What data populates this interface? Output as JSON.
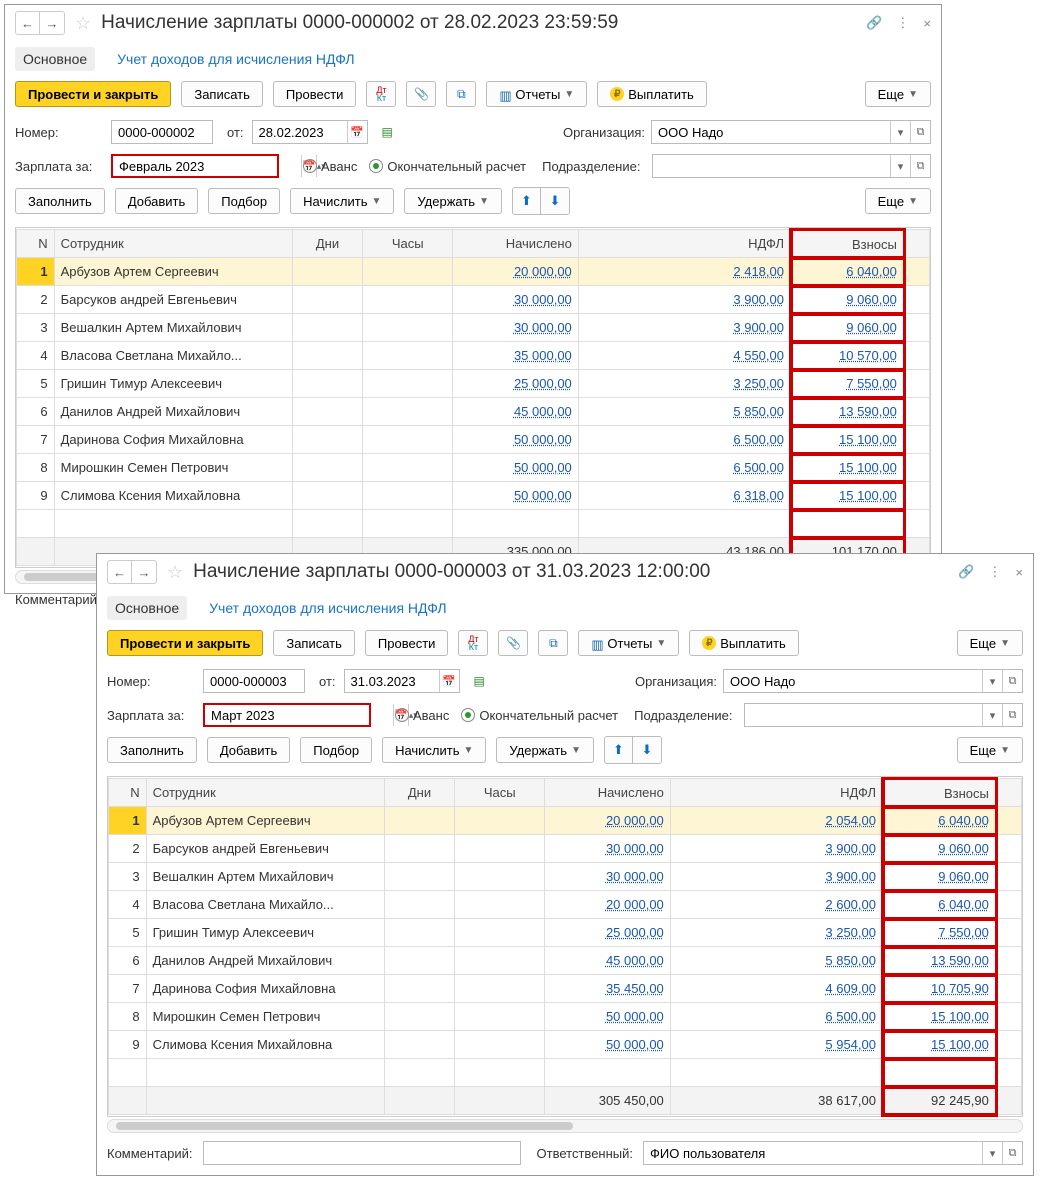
{
  "windows": [
    {
      "title": "Начисление зарплаты 0000-000002 от 28.02.2023 23:59:59",
      "tabs": {
        "main": "Основное",
        "link": "Учет доходов для исчисления НДФЛ"
      },
      "toolbar": {
        "post_close": "Провести и закрыть",
        "save": "Записать",
        "post": "Провести",
        "reports": "Отчеты",
        "pay": "Выплатить",
        "more": "Еще"
      },
      "form": {
        "number_lbl": "Номер:",
        "number_val": "0000-000002",
        "from_lbl": "от:",
        "date_val": "28.02.2023",
        "org_lbl": "Организация:",
        "org_val": "ООО Надо",
        "salary_for_lbl": "Зарплата за:",
        "period_val": "Февраль 2023",
        "advance": "Аванс",
        "final": "Окончательный расчет",
        "dept_lbl": "Подразделение:"
      },
      "toolbar2": {
        "fill": "Заполнить",
        "add": "Добавить",
        "select": "Подбор",
        "accrue": "Начислить",
        "withhold": "Удержать",
        "more": "Еще"
      },
      "columns": {
        "n": "N",
        "emp": "Сотрудник",
        "days": "Дни",
        "hours": "Часы",
        "accr": "Начислено",
        "ndfl": "НДФЛ",
        "vzn": "Взносы"
      },
      "rows": [
        {
          "n": "1",
          "emp": "Арбузов Артем Сергеевич",
          "accr": "20 000,00",
          "ndfl": "2 418,00",
          "vzn": "6 040,00",
          "hl": true
        },
        {
          "n": "2",
          "emp": "Барсуков андрей Евгеньевич",
          "accr": "30 000,00",
          "ndfl": "3 900,00",
          "vzn": "9 060,00"
        },
        {
          "n": "3",
          "emp": "Вешалкин Артем Михайлович",
          "accr": "30 000,00",
          "ndfl": "3 900,00",
          "vzn": "9 060,00"
        },
        {
          "n": "4",
          "emp": "Власова Светлана Михайло...",
          "accr": "35 000,00",
          "ndfl": "4 550,00",
          "vzn": "10 570,00"
        },
        {
          "n": "5",
          "emp": "Гришин Тимур Алексеевич",
          "accr": "25 000,00",
          "ndfl": "3 250,00",
          "vzn": "7 550,00"
        },
        {
          "n": "6",
          "emp": "Данилов Андрей Михайлович",
          "accr": "45 000,00",
          "ndfl": "5 850,00",
          "vzn": "13 590,00"
        },
        {
          "n": "7",
          "emp": "Даринова София Михайловна",
          "accr": "50 000,00",
          "ndfl": "6 500,00",
          "vzn": "15 100,00"
        },
        {
          "n": "8",
          "emp": "Мирошкин Семен Петрович",
          "accr": "50 000,00",
          "ndfl": "6 500,00",
          "vzn": "15 100,00"
        },
        {
          "n": "9",
          "emp": "Слимова Ксения Михайловна",
          "accr": "50 000,00",
          "ndfl": "6 318,00",
          "vzn": "15 100,00"
        }
      ],
      "totals": {
        "accr": "335 000,00",
        "ndfl": "43 186,00",
        "vzn": "101 170,00"
      },
      "footer": {
        "comment_lbl": "Комментарий:"
      }
    },
    {
      "title": "Начисление зарплаты 0000-000003 от 31.03.2023 12:00:00",
      "tabs": {
        "main": "Основное",
        "link": "Учет доходов для исчисления НДФЛ"
      },
      "toolbar": {
        "post_close": "Провести и закрыть",
        "save": "Записать",
        "post": "Провести",
        "reports": "Отчеты",
        "pay": "Выплатить",
        "more": "Еще"
      },
      "form": {
        "number_lbl": "Номер:",
        "number_val": "0000-000003",
        "from_lbl": "от:",
        "date_val": "31.03.2023",
        "org_lbl": "Организация:",
        "org_val": "ООО Надо",
        "salary_for_lbl": "Зарплата за:",
        "period_val": "Март 2023",
        "advance": "Аванс",
        "final": "Окончательный расчет",
        "dept_lbl": "Подразделение:"
      },
      "toolbar2": {
        "fill": "Заполнить",
        "add": "Добавить",
        "select": "Подбор",
        "accrue": "Начислить",
        "withhold": "Удержать",
        "more": "Еще"
      },
      "columns": {
        "n": "N",
        "emp": "Сотрудник",
        "days": "Дни",
        "hours": "Часы",
        "accr": "Начислено",
        "ndfl": "НДФЛ",
        "vzn": "Взносы"
      },
      "rows": [
        {
          "n": "1",
          "emp": "Арбузов Артем Сергеевич",
          "accr": "20 000,00",
          "ndfl": "2 054,00",
          "vzn": "6 040,00",
          "hl": true
        },
        {
          "n": "2",
          "emp": "Барсуков андрей Евгеньевич",
          "accr": "30 000,00",
          "ndfl": "3 900,00",
          "vzn": "9 060,00"
        },
        {
          "n": "3",
          "emp": "Вешалкин Артем Михайлович",
          "accr": "30 000,00",
          "ndfl": "3 900,00",
          "vzn": "9 060,00"
        },
        {
          "n": "4",
          "emp": "Власова Светлана Михайло...",
          "accr": "20 000,00",
          "ndfl": "2 600,00",
          "vzn": "6 040,00"
        },
        {
          "n": "5",
          "emp": "Гришин Тимур Алексеевич",
          "accr": "25 000,00",
          "ndfl": "3 250,00",
          "vzn": "7 550,00"
        },
        {
          "n": "6",
          "emp": "Данилов Андрей Михайлович",
          "accr": "45 000,00",
          "ndfl": "5 850,00",
          "vzn": "13 590,00"
        },
        {
          "n": "7",
          "emp": "Даринова София Михайловна",
          "accr": "35 450,00",
          "ndfl": "4 609,00",
          "vzn": "10 705,90"
        },
        {
          "n": "8",
          "emp": "Мирошкин Семен Петрович",
          "accr": "50 000,00",
          "ndfl": "6 500,00",
          "vzn": "15 100,00"
        },
        {
          "n": "9",
          "emp": "Слимова Ксения Михайловна",
          "accr": "50 000,00",
          "ndfl": "5 954,00",
          "vzn": "15 100,00"
        }
      ],
      "totals": {
        "accr": "305 450,00",
        "ndfl": "38 617,00",
        "vzn": "92 245,90"
      },
      "footer": {
        "comment_lbl": "Комментарий:",
        "resp_lbl": "Ответственный:",
        "resp_val": "ФИО пользователя"
      }
    }
  ]
}
